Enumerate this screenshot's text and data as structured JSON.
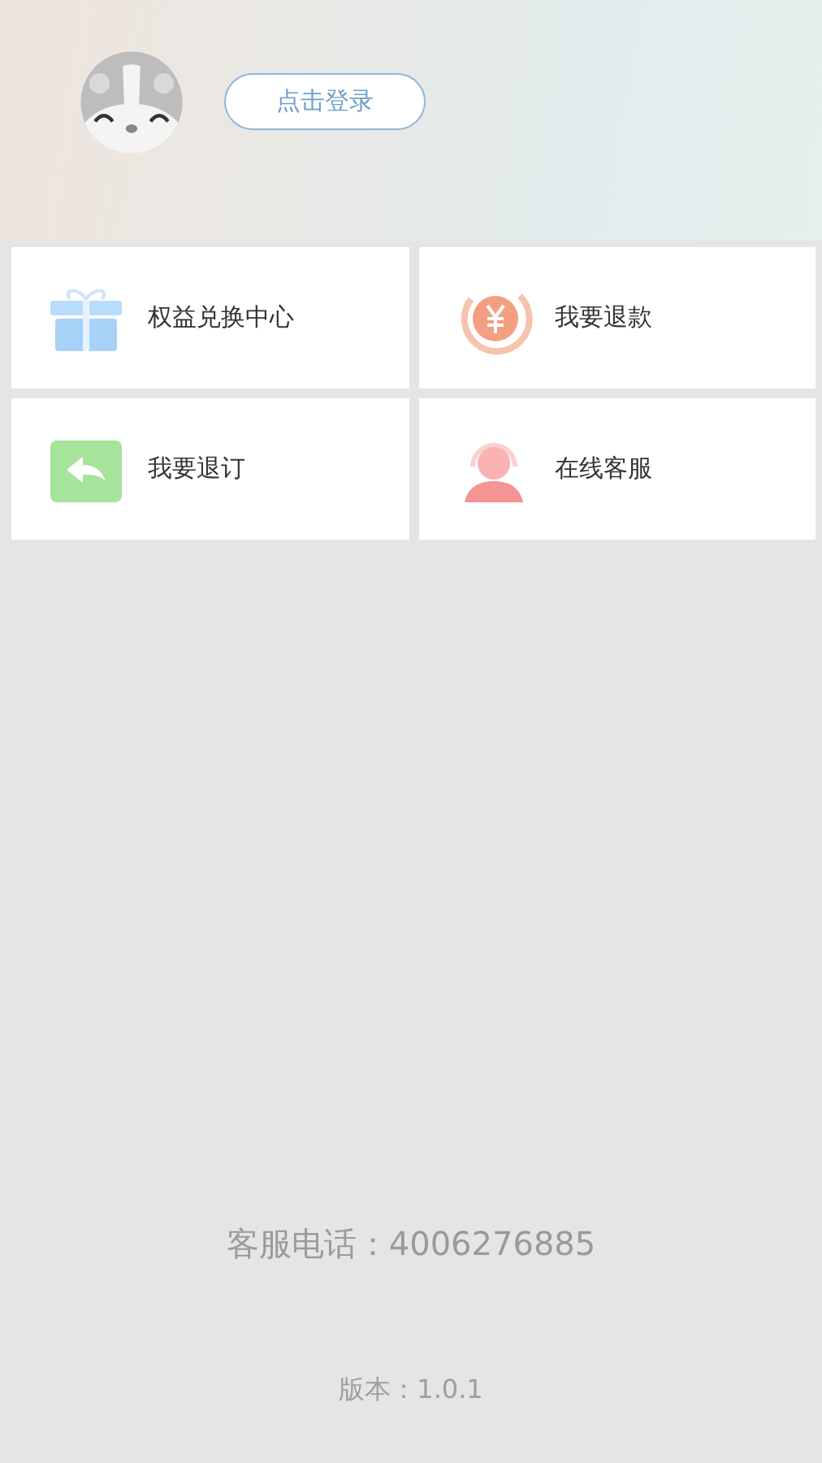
{
  "profile": {
    "login_button": "点击登录"
  },
  "menu": [
    {
      "kind": "gift",
      "label": "权益兑换中心"
    },
    {
      "kind": "refund",
      "label": "我要退款"
    },
    {
      "kind": "return",
      "label": "我要退订"
    },
    {
      "kind": "service",
      "label": "在线客服"
    }
  ],
  "footer": {
    "hotline": "客服电话：4006276885",
    "version": "版本：1.0.1"
  }
}
